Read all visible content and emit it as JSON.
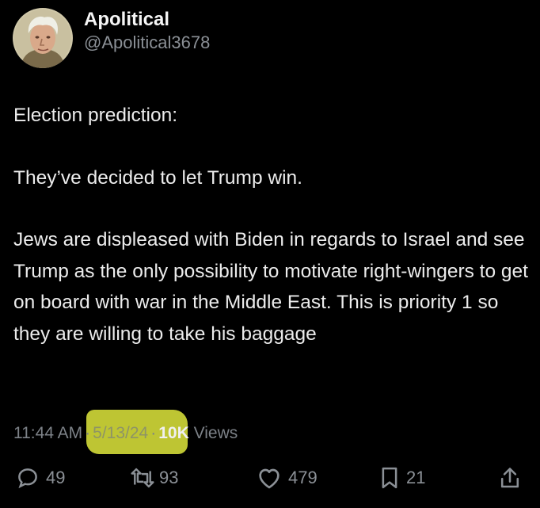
{
  "author": {
    "display_name": "Apolitical",
    "handle": "@Apolitical3678",
    "avatar_icon": "portrait-avatar"
  },
  "tweet": {
    "paragraphs": [
      "Election prediction:",
      "They’ve decided to let Trump win.",
      "Jews are displeased with Biden in regards to Israel and see Trump as the only possibility to motivate right-wingers to get on board with war in the Middle East. This is priority 1 so they are willing to take his baggage"
    ]
  },
  "meta": {
    "time": "11:44 AM",
    "separator": "·",
    "date": "5/13/24",
    "views_count": "10K",
    "views_label": "Views"
  },
  "actions": {
    "replies": "49",
    "reposts": "93",
    "likes": "479",
    "bookmarks": "21"
  },
  "colors": {
    "background": "#000000",
    "text": "#e7e9ea",
    "secondary_text": "#8b9096",
    "highlight": "#d8e03a"
  }
}
